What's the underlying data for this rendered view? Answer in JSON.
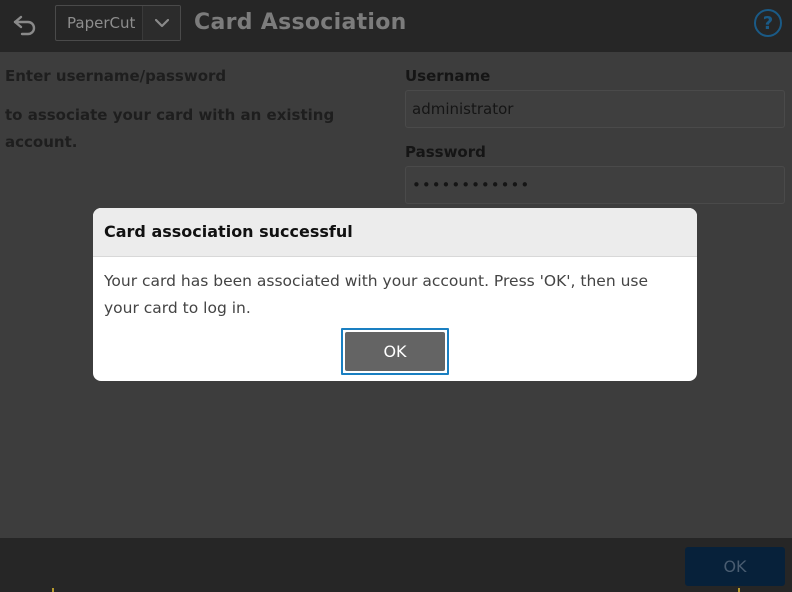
{
  "header": {
    "app_name": "PaperCut",
    "title": "Card Association",
    "help_symbol": "?"
  },
  "form": {
    "instruction_line1": "Enter username/password",
    "instruction_line2": "to associate your card with an existing account.",
    "username_label": "Username",
    "username_value": "administrator",
    "password_label": "Password",
    "password_value": "••••••••••••"
  },
  "footer": {
    "ok_label": "OK"
  },
  "dialog": {
    "title": "Card association successful",
    "message": "Your card has been associated with your account. Press 'OK', then use your card to log in.",
    "ok_label": "OK"
  },
  "colors": {
    "accent": "#1a7fc1",
    "help": "#1a5a86",
    "footer_button": "#07213a"
  },
  "icons": {
    "back": "back-arrow-icon",
    "dropdown": "chevron-down-icon",
    "help": "help-icon"
  }
}
